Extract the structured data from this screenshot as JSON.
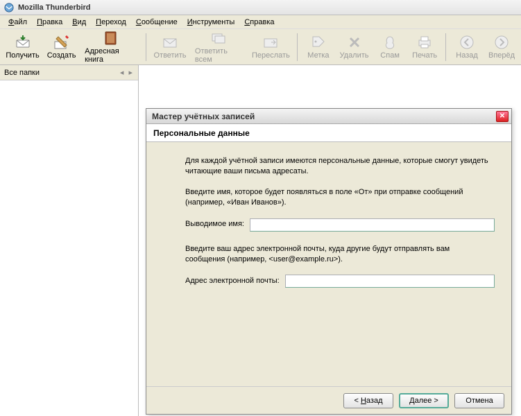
{
  "title": "Mozilla Thunderbird",
  "menu": {
    "file": "Файл",
    "edit": "Правка",
    "view": "Вид",
    "go": "Переход",
    "message": "Сообщение",
    "tools": "Инструменты",
    "help": "Справка"
  },
  "toolbar": {
    "get": "Получить",
    "create": "Создать",
    "addressbook": "Адресная книга",
    "reply": "Ответить",
    "replyall": "Ответить всем",
    "forward": "Переслать",
    "tag": "Метка",
    "delete": "Удалить",
    "junk": "Спам",
    "print": "Печать",
    "back": "Назад",
    "forward_nav": "Вперёд"
  },
  "sidebar": {
    "heading": "Все папки"
  },
  "wizard": {
    "title": "Мастер учётных записей",
    "subtitle": "Персональные данные",
    "intro": "Для каждой учётной записи имеются персональные данные, которые смогут увидеть читающие ваши письма адресаты.",
    "name_instruction": "Введите имя, которое будет появляться в поле «От» при отправке сообщений (например, «Иван Иванов»).",
    "name_label": "Выводимое имя:",
    "name_value": "",
    "email_instruction": "Введите ваш адрес электронной почты, куда другие будут отправлять вам сообщения (например, <user@example.ru>).",
    "email_label": "Адрес электронной почты:",
    "email_value": "",
    "btn_back": "< Назад",
    "btn_next": "Далее >",
    "btn_cancel": "Отмена"
  }
}
